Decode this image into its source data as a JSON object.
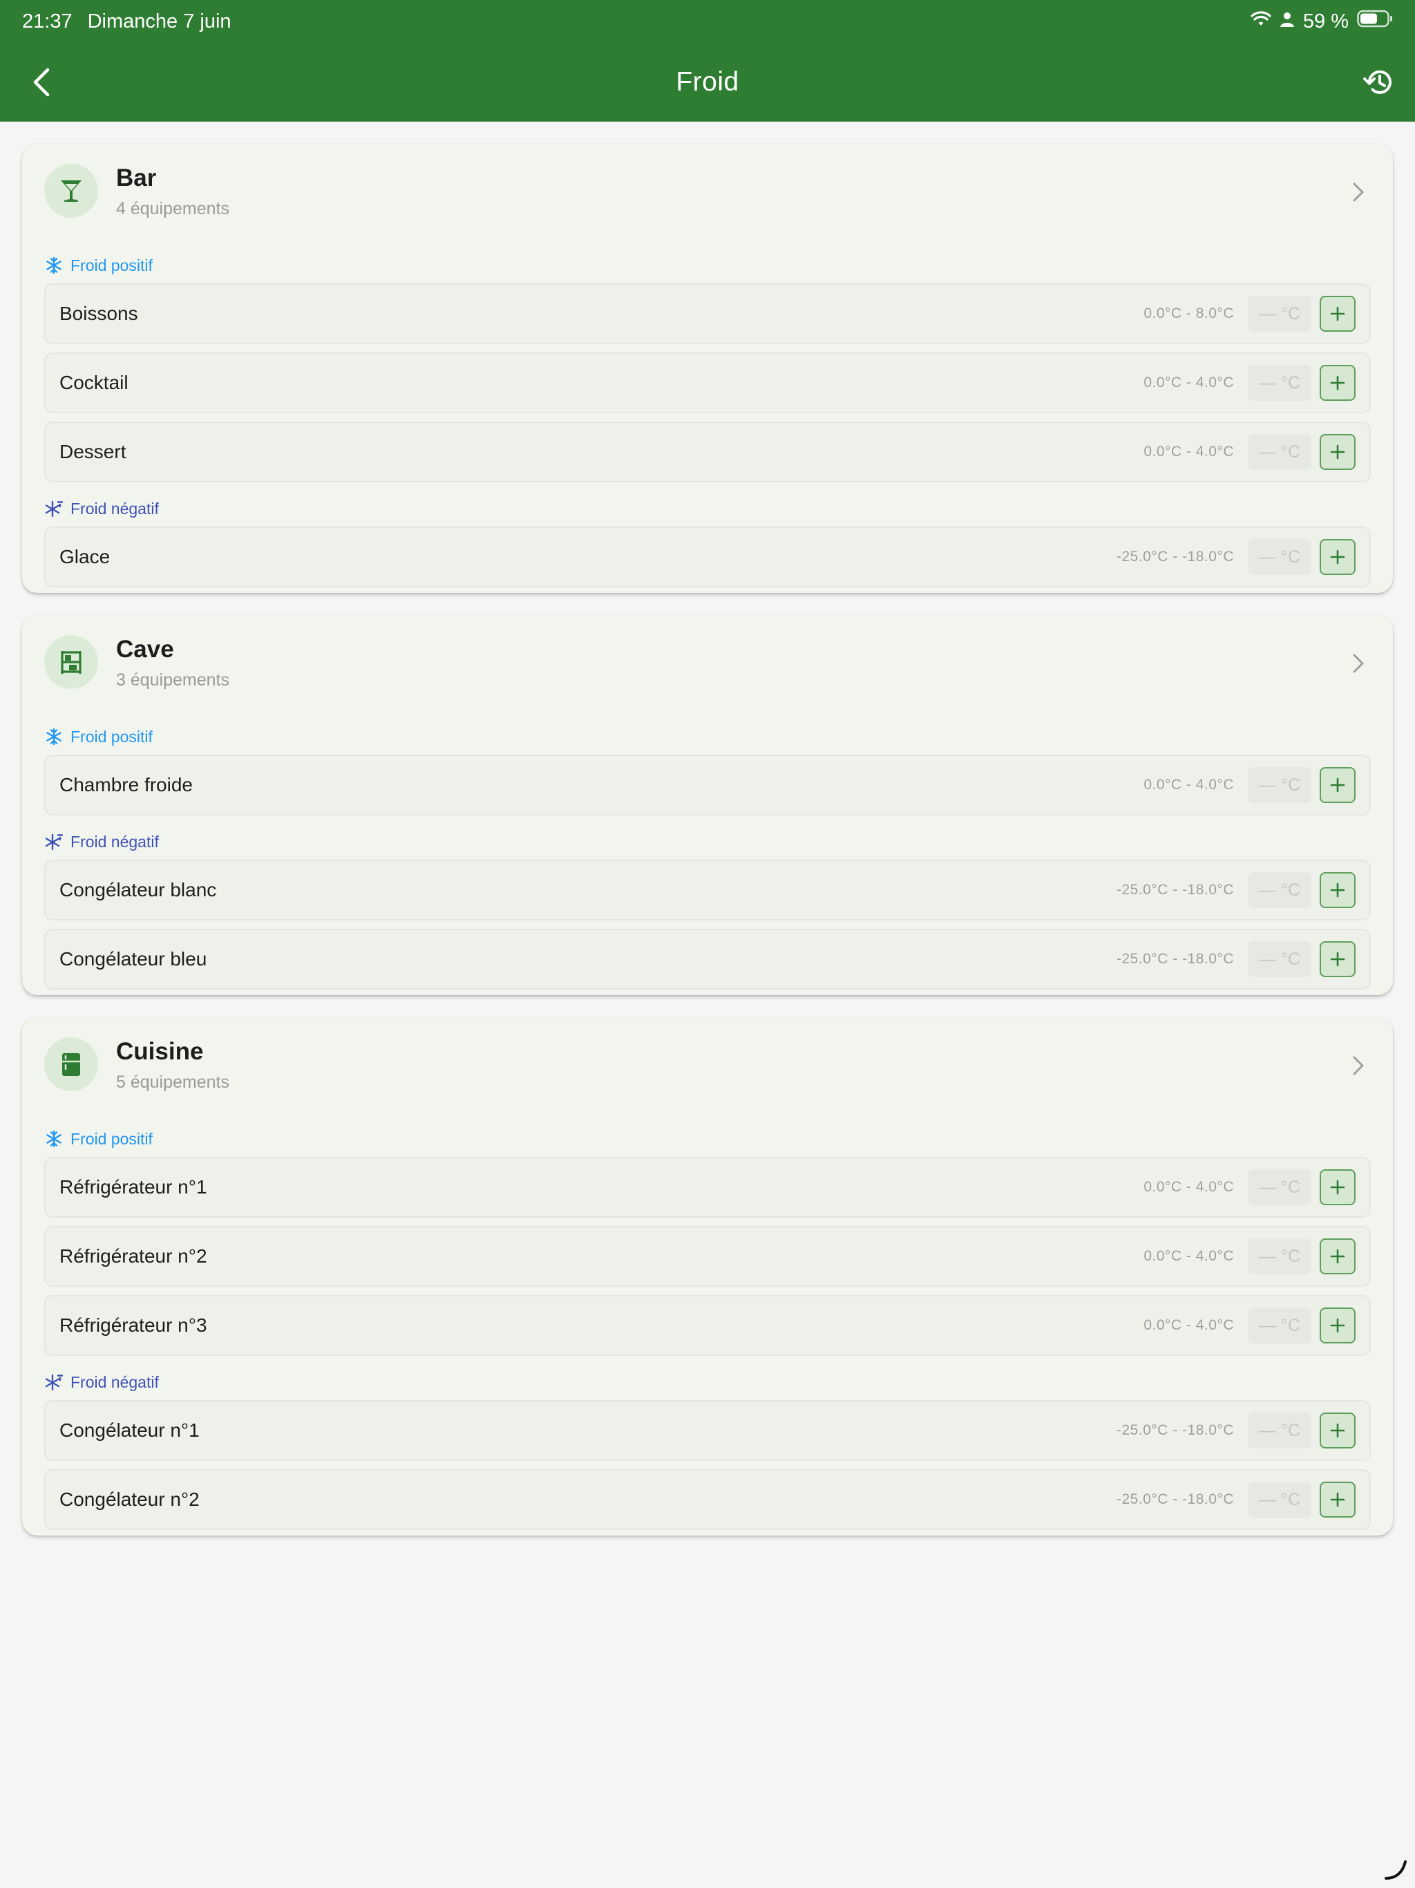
{
  "status": {
    "time": "21:37",
    "date": "Dimanche 7 juin",
    "battery": "59 %"
  },
  "appbar": {
    "title": "Froid"
  },
  "groups": [
    {
      "name": "Bar",
      "count": "4 équipements",
      "icon": "cocktail-icon",
      "sections": [
        {
          "label": "Froid positif",
          "kind": "pos",
          "items": [
            {
              "name": "Boissons",
              "range": "0.0°C - 8.0°C",
              "placeholder": "— °C"
            },
            {
              "name": "Cocktail",
              "range": "0.0°C - 4.0°C",
              "placeholder": "— °C"
            },
            {
              "name": "Dessert",
              "range": "0.0°C - 4.0°C",
              "placeholder": "— °C"
            }
          ]
        },
        {
          "label": "Froid négatif",
          "kind": "neg",
          "items": [
            {
              "name": "Glace",
              "range": "-25.0°C - -18.0°C",
              "placeholder": "— °C"
            }
          ]
        }
      ]
    },
    {
      "name": "Cave",
      "count": "3 équipements",
      "icon": "shelves-icon",
      "sections": [
        {
          "label": "Froid positif",
          "kind": "pos",
          "items": [
            {
              "name": "Chambre froide",
              "range": "0.0°C - 4.0°C",
              "placeholder": "— °C"
            }
          ]
        },
        {
          "label": "Froid négatif",
          "kind": "neg",
          "items": [
            {
              "name": "Congélateur blanc",
              "range": "-25.0°C - -18.0°C",
              "placeholder": "— °C"
            },
            {
              "name": "Congélateur bleu",
              "range": "-25.0°C - -18.0°C",
              "placeholder": "— °C"
            }
          ]
        }
      ]
    },
    {
      "name": "Cuisine",
      "count": "5 équipements",
      "icon": "fridge-icon",
      "sections": [
        {
          "label": "Froid positif",
          "kind": "pos",
          "items": [
            {
              "name": "Réfrigérateur n°1",
              "range": "0.0°C - 4.0°C",
              "placeholder": "— °C"
            },
            {
              "name": "Réfrigérateur n°2",
              "range": "0.0°C - 4.0°C",
              "placeholder": "— °C"
            },
            {
              "name": "Réfrigérateur n°3",
              "range": "0.0°C - 4.0°C",
              "placeholder": "— °C"
            }
          ]
        },
        {
          "label": "Froid négatif",
          "kind": "neg",
          "items": [
            {
              "name": "Congélateur n°1",
              "range": "-25.0°C - -18.0°C",
              "placeholder": "— °C"
            },
            {
              "name": "Congélateur n°2",
              "range": "-25.0°C - -18.0°C",
              "placeholder": "— °C"
            }
          ]
        }
      ]
    }
  ],
  "colors": {
    "primary": "#2e7d32",
    "positive": "#2196f3",
    "negative": "#3f51b5"
  }
}
